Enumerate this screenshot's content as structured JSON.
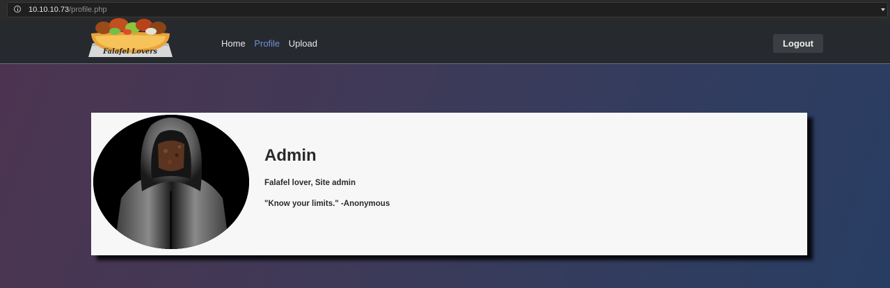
{
  "browser": {
    "url_host": "10.10.10.73",
    "url_path": "/profile.php"
  },
  "navbar": {
    "logo_text": "Falafel Lovers",
    "links": [
      {
        "label": "Home",
        "active": false
      },
      {
        "label": "Profile",
        "active": true
      },
      {
        "label": "Upload",
        "active": false
      }
    ],
    "logout_label": "Logout"
  },
  "profile": {
    "name": "Admin",
    "role": "Falafel lover, Site admin",
    "quote": "\"Know your limits.\" -Anonymous",
    "avatar": "hooded-figure-avatar"
  },
  "colors": {
    "active_link": "#6f8fd8",
    "navbar_bg": "#262a2f",
    "card_bg": "#f7f7f7"
  }
}
